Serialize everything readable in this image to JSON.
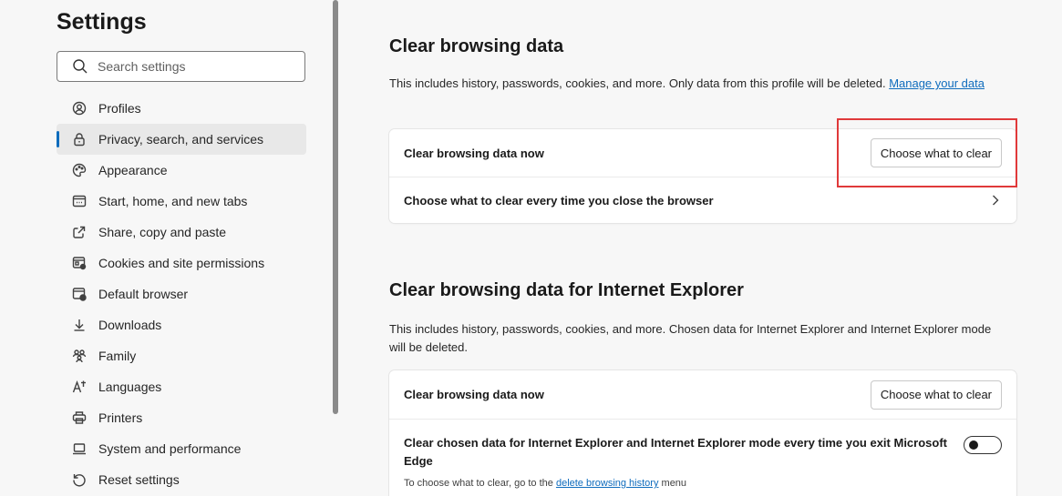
{
  "sidebar": {
    "title": "Settings",
    "search_placeholder": "Search settings",
    "items": [
      {
        "label": "Profiles",
        "icon": "profile-icon"
      },
      {
        "label": "Privacy, search, and services",
        "icon": "lock-icon",
        "active": true
      },
      {
        "label": "Appearance",
        "icon": "appearance-icon"
      },
      {
        "label": "Start, home, and new tabs",
        "icon": "start-home-icon"
      },
      {
        "label": "Share, copy and paste",
        "icon": "share-icon"
      },
      {
        "label": "Cookies and site permissions",
        "icon": "cookies-icon"
      },
      {
        "label": "Default browser",
        "icon": "default-browser-icon"
      },
      {
        "label": "Downloads",
        "icon": "download-icon"
      },
      {
        "label": "Family",
        "icon": "family-icon"
      },
      {
        "label": "Languages",
        "icon": "languages-icon"
      },
      {
        "label": "Printers",
        "icon": "printer-icon"
      },
      {
        "label": "System and performance",
        "icon": "laptop-icon"
      },
      {
        "label": "Reset settings",
        "icon": "reset-icon"
      }
    ]
  },
  "clear_browsing": {
    "title": "Clear browsing data",
    "description": "This includes history, passwords, cookies, and more. Only data from this profile will be deleted.",
    "manage_link": "Manage your data",
    "row1_label": "Clear browsing data now",
    "row1_button": "Choose what to clear",
    "row2_label": "Choose what to clear every time you close the browser"
  },
  "clear_ie": {
    "title": "Clear browsing data for Internet Explorer",
    "description": "This includes history, passwords, cookies, and more. Chosen data for Internet Explorer and Internet Explorer mode will be deleted.",
    "row1_label": "Clear browsing data now",
    "row1_button": "Choose what to clear",
    "row2_label": "Clear chosen data for Internet Explorer and Internet Explorer mode every time you exit Microsoft Edge",
    "row2_note_prefix": "To choose what to clear, go to the",
    "row2_note_link": "delete browsing history",
    "row2_note_suffix": "menu",
    "toggle_on": false
  },
  "colors": {
    "accent": "#0f6cbd",
    "highlight": "#e0393a"
  }
}
